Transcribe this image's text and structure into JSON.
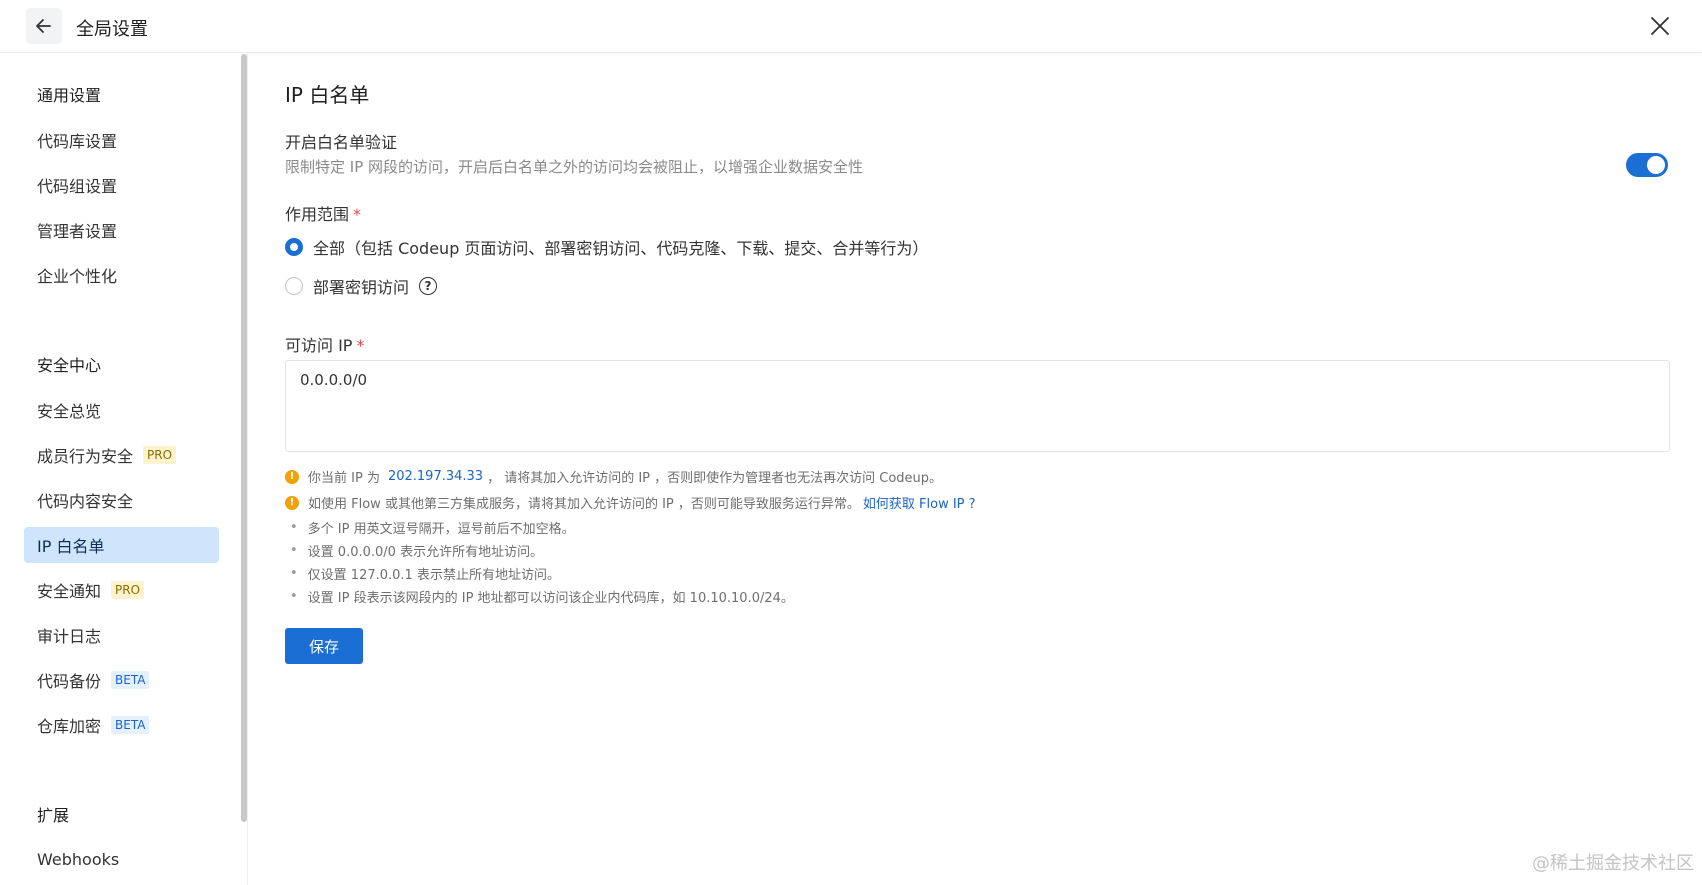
{
  "header": {
    "title": "全局设置"
  },
  "sidebar": {
    "sections": [
      {
        "label": "通用设置"
      },
      {
        "label": "安全中心"
      },
      {
        "label": "扩展"
      }
    ],
    "items": [
      {
        "label": "代码库设置"
      },
      {
        "label": "代码组设置"
      },
      {
        "label": "管理者设置"
      },
      {
        "label": "企业个性化"
      },
      {
        "label": "安全总览"
      },
      {
        "label": "成员行为安全",
        "badge": "PRO"
      },
      {
        "label": "代码内容安全"
      },
      {
        "label": "IP 白名单",
        "active": true
      },
      {
        "label": "安全通知",
        "badge": "PRO"
      },
      {
        "label": "审计日志"
      },
      {
        "label": "代码备份",
        "badge": "BETA"
      },
      {
        "label": "仓库加密",
        "badge": "BETA"
      },
      {
        "label": "Webhooks"
      }
    ]
  },
  "main": {
    "title": "IP 白名单",
    "toggle_label": "开启白名单验证",
    "toggle_desc": "限制特定 IP 网段的访问，开启后白名单之外的访问均会被阻止，以增强企业数据安全性",
    "toggle_on": true,
    "scope_label": "作用范围",
    "scope_options": [
      {
        "label": "全部（包括 Codeup 页面访问、部署密钥访问、代码克隆、下载、提交、合并等行为）",
        "checked": true
      },
      {
        "label": "部署密钥访问",
        "checked": false
      }
    ],
    "ip_label": "可访问 IP",
    "ip_value": "0.0.0.0/0",
    "warning1_prefix": "你当前 IP 为",
    "current_ip": "202.197.34.33",
    "warning1_suffix": "，  请将其加入允许访问的 IP ，否则即使作为管理者也无法再次访问 Codeup。",
    "warning2_text": "如使用 Flow 或其他第三方集成服务，请将其加入允许访问的 IP ，否则可能导致服务运行异常。",
    "warning2_link": "如何获取 Flow IP ?",
    "tips": [
      "多个 IP 用英文逗号隔开，逗号前后不加空格。",
      "设置 0.0.0.0/0 表示允许所有地址访问。",
      "仅设置 127.0.0.1 表示禁止所有地址访问。",
      "设置 IP 段表示该网段内的 IP 地址都可以访问该企业内代码库，如 10.10.10.0/24。"
    ],
    "save_label": "保存"
  },
  "watermark": "@稀土掘金技术社区",
  "colors": {
    "accent": "#1b6fd4",
    "active_bg": "#cfe5fb",
    "warning": "#f1a10a"
  }
}
